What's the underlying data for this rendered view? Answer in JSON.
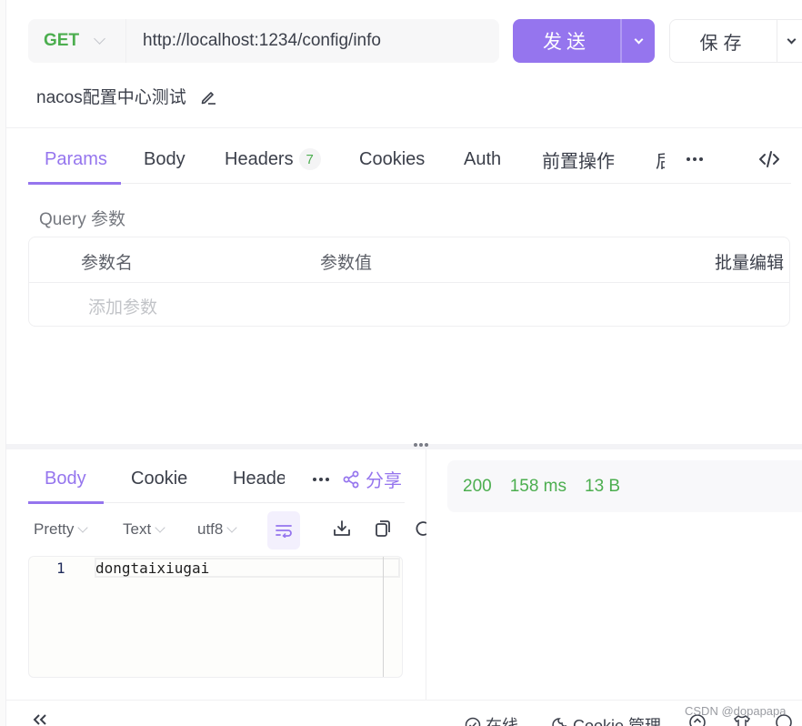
{
  "request": {
    "method": "GET",
    "url": "http://localhost:1234/config/info",
    "send_label": "发送",
    "save_label": "保存",
    "name": "nacos配置中心测试"
  },
  "request_tabs": [
    {
      "label": "Params",
      "active": true
    },
    {
      "label": "Body"
    },
    {
      "label": "Headers",
      "badge": "7"
    },
    {
      "label": "Cookies"
    },
    {
      "label": "Auth"
    },
    {
      "label": "前置操作"
    },
    {
      "label": "后"
    }
  ],
  "params": {
    "section_label": "Query 参数",
    "columns": [
      "参数名",
      "参数值"
    ],
    "bulk_edit_label": "批量编辑",
    "add_placeholder": "添加参数"
  },
  "response_tabs": [
    {
      "label": "Body",
      "active": true
    },
    {
      "label": "Cookie"
    },
    {
      "label": "Heade"
    }
  ],
  "share_label": "分享",
  "response_status": {
    "code": "200",
    "time": "158 ms",
    "size": "13 B",
    "color": "#4cae4f"
  },
  "toolbar": {
    "format": "Pretty",
    "type": "Text",
    "encoding": "utf8"
  },
  "editor": {
    "lines": [
      {
        "no": "1",
        "text": "dongtaixiugai"
      }
    ]
  },
  "footer": {
    "online_label": "在线",
    "cookie_label": "Cookie 管理",
    "watermark": "CSDN @dopapapa"
  },
  "accent_color": "#9575ee"
}
